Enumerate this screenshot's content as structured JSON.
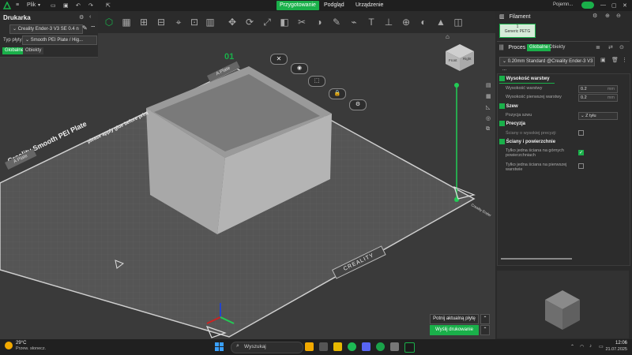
{
  "titlebar": {
    "file_menu": "Plik",
    "tabs": [
      {
        "label": "Przygotowanie",
        "active": true
      },
      {
        "label": "Podgląd",
        "active": false
      },
      {
        "label": "Urządzenie",
        "active": false
      }
    ],
    "user": "Pojemn..."
  },
  "printer": {
    "title": "Drukarka",
    "model": "Creality Ender-3 V3 SE 0.4 n",
    "plate_label": "Typ płyty",
    "plate_value": "Smooth PEI Plate / Hig...",
    "toggle_global": "Globalne",
    "toggle_objects": "Obiekty"
  },
  "plate": {
    "number": "01",
    "name_left": "A Plate",
    "name_top": "A Plate",
    "title": "Creality Smooth PEI Plate",
    "note": "please apply glue before print",
    "brand": "CREALITY",
    "nameplate": "Creality Ender"
  },
  "cube_labels": {
    "front": "Front",
    "right": "Right"
  },
  "filament": {
    "title": "Filament",
    "slot_number": "1",
    "slot_name": "Generic PETG",
    "slot_color": "#d6ecd9"
  },
  "process": {
    "title": "Proces",
    "toggle_global": "Globalne",
    "toggle_objects": "Obiekty",
    "profile": "0.20mm Standard @Creality Ender-3 V3 ..."
  },
  "params": {
    "layer_height_section": "Wysokość warstwy",
    "layer_height_label": "Wysokość warstwy",
    "layer_height_value": "0.2",
    "first_layer_label": "Wysokość pierwszej warstwy",
    "first_layer_value": "0.2",
    "unit": "mm",
    "seam_section": "Szew",
    "seam_pos_label": "Pozycja szwu",
    "seam_pos_value": "Z tyłu",
    "precision_section": "Precyzja",
    "high_precision_walls": "Ściany o wysokiej precyzji",
    "high_precision_checked": false,
    "walls_section": "Ściany i powierzchnie",
    "top_one_wall": "Tylko jedna ściana na górnych powierzchniach",
    "top_one_wall_checked": true,
    "first_one_wall": "Tylko jedna ściana na pierwszej warstwie",
    "first_one_wall_checked": false
  },
  "actions": {
    "slice": "Potnij aktualną płytę",
    "print": "Wyślij drukowanie"
  },
  "taskbar": {
    "temp": "29°C",
    "weather": "Przew. słonecz.",
    "search": "Wyszukaj",
    "time": "12:06",
    "date": "21.07.2025"
  },
  "colors": {
    "accent": "#1ab04a",
    "axis_green": "#22cc55",
    "axis_red": "#cc2222",
    "axis_blue": "#2244cc"
  }
}
